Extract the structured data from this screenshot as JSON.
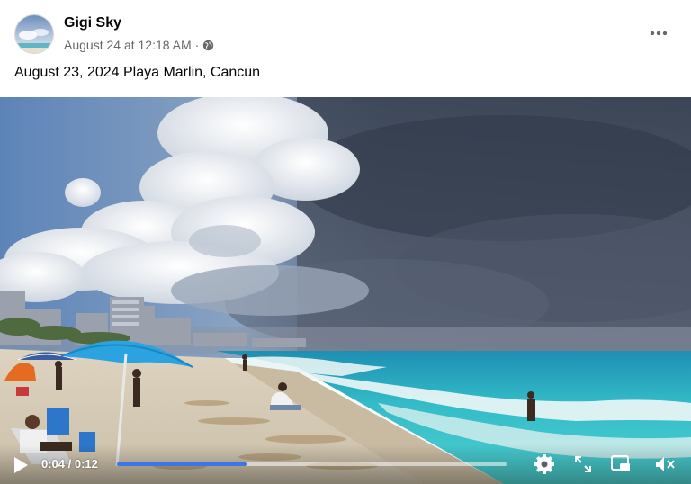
{
  "post": {
    "author": "Gigi Sky",
    "timestamp": "August 24 at 12:18 AM",
    "separator": "·",
    "audience_icon": "globe-icon",
    "more_icon": "more-options-icon",
    "caption": "August 23, 2024 Playa Marlin, Cancun"
  },
  "video": {
    "current_time": "0:04",
    "duration": "0:12",
    "time_display": "0:04 / 0:12",
    "progress_fraction": 0.333,
    "icons": {
      "play": "play-icon",
      "settings": "gear-icon",
      "fullscreen": "fullscreen-icon",
      "pip": "picture-in-picture-icon",
      "mute": "muted-speaker-icon"
    },
    "colors": {
      "progress": "#3b75e6",
      "track": "#ffffffa0"
    }
  }
}
